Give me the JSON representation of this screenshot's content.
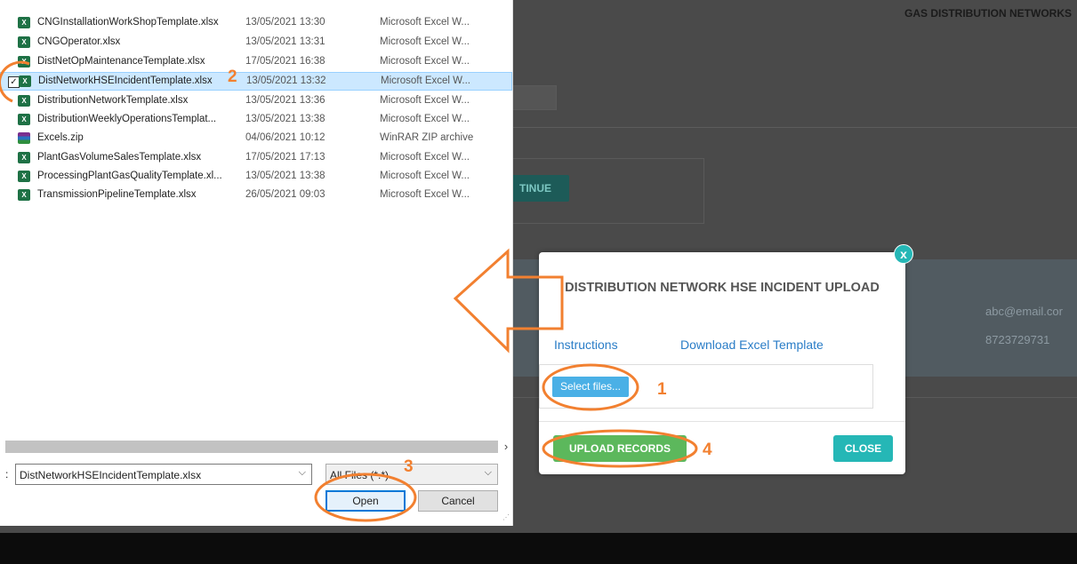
{
  "background": {
    "title": "GAS DISTRIBUTION NETWORKS",
    "continue_label": "TINUE",
    "email": "abc@email.cor",
    "phone": "8723729731"
  },
  "file_dialog": {
    "files": [
      {
        "name": "CNGInstallationWorkShopTemplate.xlsx",
        "date": "13/05/2021 13:30",
        "type": "Microsoft Excel W...",
        "icon": "excel-file-icon",
        "selected": false
      },
      {
        "name": "CNGOperator.xlsx",
        "date": "13/05/2021 13:31",
        "type": "Microsoft Excel W...",
        "icon": "excel-file-icon",
        "selected": false
      },
      {
        "name": "DistNetOpMaintenanceTemplate.xlsx",
        "date": "17/05/2021 16:38",
        "type": "Microsoft Excel W...",
        "icon": "excel-file-icon",
        "selected": false
      },
      {
        "name": "DistNetworkHSEIncidentTemplate.xlsx",
        "date": "13/05/2021 13:32",
        "type": "Microsoft Excel W...",
        "icon": "excel-file-icon",
        "selected": true
      },
      {
        "name": "DistributionNetworkTemplate.xlsx",
        "date": "13/05/2021 13:36",
        "type": "Microsoft Excel W...",
        "icon": "excel-file-icon",
        "selected": false
      },
      {
        "name": "DistributionWeeklyOperationsTemplat...",
        "date": "13/05/2021 13:38",
        "type": "Microsoft Excel W...",
        "icon": "excel-file-icon",
        "selected": false
      },
      {
        "name": "Excels.zip",
        "date": "04/06/2021 10:12",
        "type": "WinRAR ZIP archive",
        "icon": "winrar-archive-icon",
        "selected": false
      },
      {
        "name": "PlantGasVolumeSalesTemplate.xlsx",
        "date": "17/05/2021 17:13",
        "type": "Microsoft Excel W...",
        "icon": "excel-file-icon",
        "selected": false
      },
      {
        "name": "ProcessingPlantGasQualityTemplate.xl...",
        "date": "13/05/2021 13:38",
        "type": "Microsoft Excel W...",
        "icon": "excel-file-icon",
        "selected": false
      },
      {
        "name": "TransmissionPipelineTemplate.xlsx",
        "date": "26/05/2021 09:03",
        "type": "Microsoft Excel W...",
        "icon": "excel-file-icon",
        "selected": false
      }
    ],
    "filename_prefix": ":",
    "filename_value": "DistNetworkHSEIncidentTemplate.xlsx",
    "filter_value": "All Files (*.*)",
    "open_label": "Open",
    "cancel_label": "Cancel"
  },
  "modal": {
    "close_icon": "x",
    "title": "DISTRIBUTION NETWORK HSE INCIDENT UPLOAD",
    "instructions_label": "Instructions",
    "download_label": "Download Excel Template",
    "select_files_label": "Select files...",
    "upload_label": "UPLOAD RECORDS",
    "close_label": "CLOSE"
  },
  "annotations": {
    "step_1": "1",
    "step_2": "2",
    "step_3": "3",
    "step_4": "4",
    "color": "#f28030"
  }
}
